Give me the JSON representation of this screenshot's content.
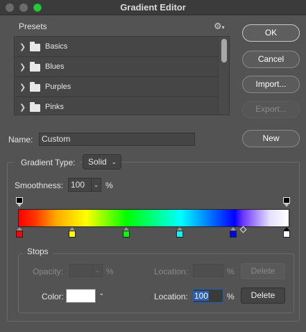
{
  "window": {
    "title": "Gradient Editor"
  },
  "presets": {
    "label": "Presets",
    "items": [
      {
        "label": "Basics"
      },
      {
        "label": "Blues"
      },
      {
        "label": "Purples"
      },
      {
        "label": "Pinks"
      }
    ]
  },
  "buttons": {
    "ok": "OK",
    "cancel": "Cancel",
    "import": "Import...",
    "export": "Export...",
    "new": "New"
  },
  "name": {
    "label": "Name:",
    "value": "Custom"
  },
  "gradient": {
    "type_label": "Gradient Type:",
    "type_value": "Solid",
    "smoothness_label": "Smoothness:",
    "smoothness_value": "100",
    "smoothness_unit": "%",
    "color_stops": [
      "#ff0000",
      "#ffff00",
      "#00ff00",
      "#00ffff",
      "#0000ff",
      "#ffffff"
    ]
  },
  "stops": {
    "label": "Stops",
    "opacity_label": "Opacity:",
    "opacity_unit": "%",
    "opacity_location_label": "Location:",
    "opacity_location_unit": "%",
    "opacity_delete": "Delete",
    "color_label": "Color:",
    "color_value": "#ffffff",
    "color_location_label": "Location:",
    "color_location_value": "100",
    "color_location_unit": "%",
    "color_delete": "Delete"
  }
}
